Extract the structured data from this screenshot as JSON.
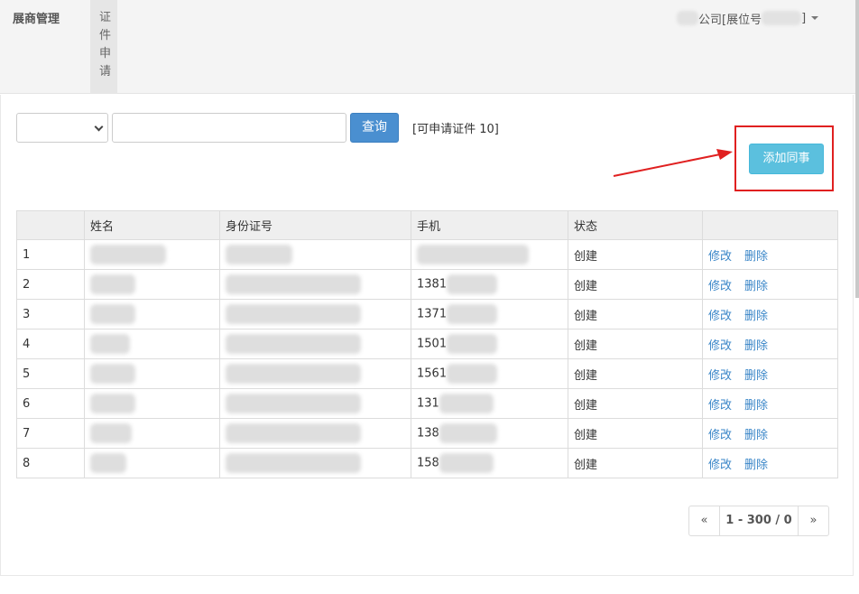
{
  "nav": {
    "brand": "展商管理",
    "tab_label": "证件申请",
    "user_company_text": "公司[展位号",
    "user_suffix": "]"
  },
  "toolbar": {
    "select_value": "",
    "search_value": "",
    "search_placeholder": "",
    "query_label": "查询",
    "quota_text": "[可申请证件 10]",
    "add_label": "添加同事"
  },
  "table": {
    "columns": [
      "",
      "姓名",
      "身份证号",
      "手机",
      "状态",
      ""
    ],
    "rows": [
      {
        "no": "1",
        "phone_prefix": "",
        "status": "创建",
        "edit": "修改",
        "delete": "删除"
      },
      {
        "no": "2",
        "phone_prefix": "1381",
        "status": "创建",
        "edit": "修改",
        "delete": "删除"
      },
      {
        "no": "3",
        "phone_prefix": "1371",
        "status": "创建",
        "edit": "修改",
        "delete": "删除"
      },
      {
        "no": "4",
        "phone_prefix": "1501",
        "status": "创建",
        "edit": "修改",
        "delete": "删除"
      },
      {
        "no": "5",
        "phone_prefix": "1561",
        "status": "创建",
        "edit": "修改",
        "delete": "删除"
      },
      {
        "no": "6",
        "phone_prefix": "131",
        "status": "创建",
        "edit": "修改",
        "delete": "删除"
      },
      {
        "no": "7",
        "phone_prefix": "138",
        "status": "创建",
        "edit": "修改",
        "delete": "删除"
      },
      {
        "no": "8",
        "phone_prefix": "158",
        "status": "创建",
        "edit": "修改",
        "delete": "删除"
      }
    ]
  },
  "pager": {
    "prev": "«",
    "info": "1 - 300 / 0",
    "next": "»"
  },
  "colors": {
    "accent": "#4a8fd0",
    "add_button": "#5bc0de",
    "highlight": "#e02020",
    "link": "#3a86c8"
  }
}
